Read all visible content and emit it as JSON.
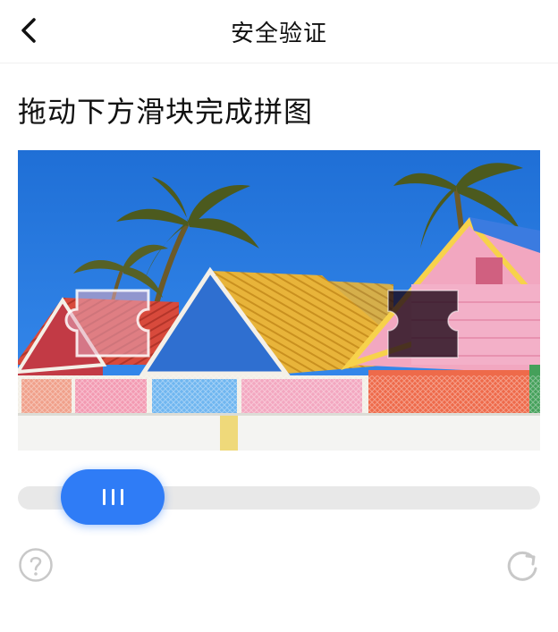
{
  "header": {
    "title": "安全验证",
    "back_icon": "chevron-left-icon"
  },
  "instruction": "拖动下方滑块完成拼图",
  "puzzle": {
    "scene": "colorful-rooftops-palm-trees",
    "slider_progress": 0.09
  },
  "footer": {
    "help_icon": "question-circle-icon",
    "refresh_icon": "refresh-icon"
  },
  "colors": {
    "accent": "#2f7cf6",
    "track": "#e8e8e8",
    "icon_gray": "#c8c8c8"
  }
}
